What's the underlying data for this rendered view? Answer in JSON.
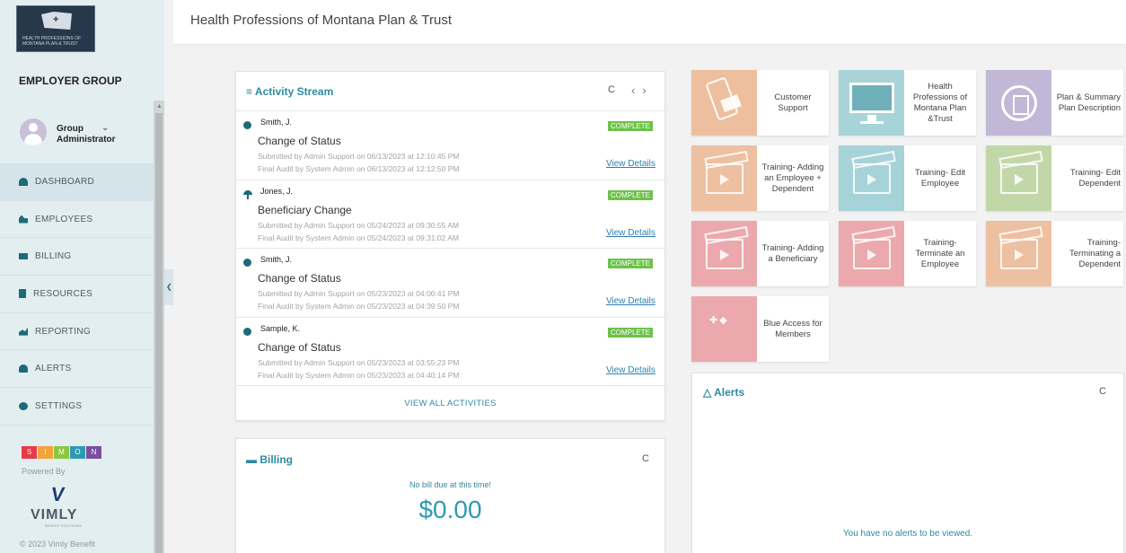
{
  "header": {
    "title": "Health Professions of Montana Plan & Trust"
  },
  "sidebar": {
    "logo_text": "HEALTH PROFESSIONS OF MONTANA PLAN & TRUST",
    "group_label": "EMPLOYER GROUP",
    "user": {
      "name": "Group Administrator"
    },
    "items": [
      {
        "label": "DASHBOARD",
        "icon": "dashboard-icon"
      },
      {
        "label": "EMPLOYEES",
        "icon": "users-icon"
      },
      {
        "label": "BILLING",
        "icon": "card-icon"
      },
      {
        "label": "RESOURCES",
        "icon": "book-icon"
      },
      {
        "label": "REPORTING",
        "icon": "chart-icon"
      },
      {
        "label": "ALERTS",
        "icon": "bell-icon"
      },
      {
        "label": "SETTINGS",
        "icon": "gear-icon"
      }
    ],
    "simon_letters": [
      "S",
      "I",
      "M",
      "O",
      "N"
    ],
    "powered_by": "Powered By",
    "vimly": "VIMLY",
    "vimly_sub": "BENEFIT SOLUTIONS",
    "copyright": "© 2023 Vimly Benefit"
  },
  "activity": {
    "title": "Activity Stream",
    "view_all": "VIEW ALL ACTIVITIES",
    "items": [
      {
        "name": "Smith, J.",
        "type": "Change of Status",
        "status": "COMPLETE",
        "submitted": "Submitted by Admin Support on 06/13/2023 at 12:10:45 PM",
        "audit": "Final Audit by System Admin on 06/13/2023 at 12:12:50 PM",
        "link": "View Details",
        "icon": "status-change-icon"
      },
      {
        "name": "Jones, J.",
        "type": "Beneficiary Change",
        "status": "COMPLETE",
        "submitted": "Submitted by Admin Support on 05/24/2023 at 09:30:55 AM",
        "audit": "Final Audit by System Admin on 05/24/2023 at 09:31:02 AM",
        "link": "View Details",
        "icon": "umbrella-icon"
      },
      {
        "name": "Smith, J.",
        "type": "Change of Status",
        "status": "COMPLETE",
        "submitted": "Submitted by Admin Support on 05/23/2023 at 04:00:41 PM",
        "audit": "Final Audit by System Admin on 05/23/2023 at 04:39:50 PM",
        "link": "View Details",
        "icon": "status-change-icon"
      },
      {
        "name": "Sample, K.",
        "type": "Change of Status",
        "status": "COMPLETE",
        "submitted": "Submitted by Admin Support on 05/23/2023 at 03:55:23 PM",
        "audit": "Final Audit by System Admin on 05/23/2023 at 04:40:14 PM",
        "link": "View Details",
        "icon": "status-change-icon"
      }
    ]
  },
  "billing": {
    "title": "Billing",
    "message": "No bill due at this time!",
    "amount": "$0.00"
  },
  "tiles": [
    {
      "label": "Customer Support",
      "color": "#eebf9e"
    },
    {
      "label": "Health Professions of Montana Plan &Trust",
      "color": "#a8d4d9"
    },
    {
      "label": "Plan & Summary Plan Description",
      "color": "#c1b8d8"
    },
    {
      "label": "Training- Adding an Employee + Dependent",
      "color": "#edc0a1"
    },
    {
      "label": "Training- Edit Employee",
      "color": "#a6d3d8"
    },
    {
      "label": "Training- Edit Dependent",
      "color": "#c2d7a8"
    },
    {
      "label": "Training- Adding a Beneficiary",
      "color": "#eba9ad"
    },
    {
      "label": "Training- Terminate an Employee",
      "color": "#eba9ad"
    },
    {
      "label": "Training- Terminating a Dependent",
      "color": "#edc0a1"
    },
    {
      "label": "Blue Access for Members",
      "color": "#eba9ad"
    }
  ],
  "alerts": {
    "title": "Alerts",
    "message": "You have no alerts to be viewed."
  },
  "colors": {
    "accent": "#2d8aa0",
    "badge": "#6cc24a",
    "sidebar_bg": "#e3eef0"
  }
}
